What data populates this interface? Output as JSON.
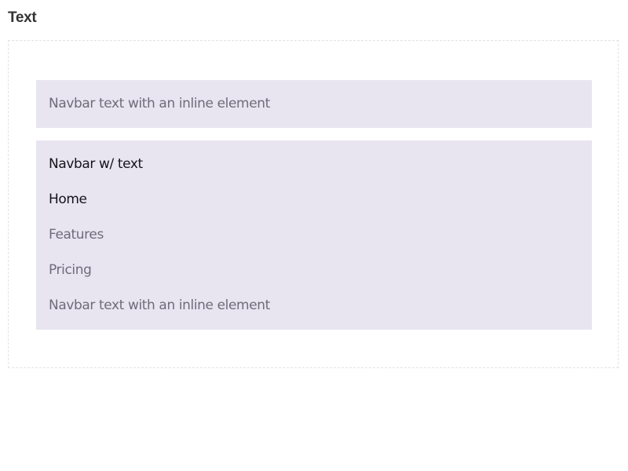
{
  "section": {
    "title": "Text"
  },
  "navbar_one": {
    "text": "Navbar text with an inline element"
  },
  "navbar_two": {
    "brand": "Navbar w/ text",
    "links": [
      {
        "label": "Home",
        "active": true
      },
      {
        "label": "Features",
        "active": false
      },
      {
        "label": "Pricing",
        "active": false
      }
    ],
    "text": "Navbar text with an inline element"
  },
  "colors": {
    "navbar_background": "#e8e5f1",
    "active_text": "#16131c",
    "muted_text": "#6f6b79",
    "frame_border": "#e2e2e2",
    "title_text": "#333333"
  }
}
